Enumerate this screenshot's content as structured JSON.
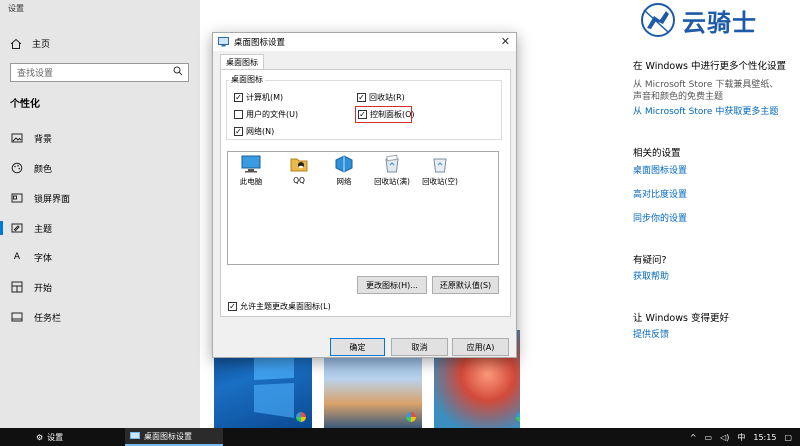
{
  "settings": {
    "title": "设置",
    "home": "主页",
    "search_placeholder": "查找设置",
    "section": "个性化",
    "nav": [
      {
        "label": "背景"
      },
      {
        "label": "颜色"
      },
      {
        "label": "锁屏界面"
      },
      {
        "label": "主题"
      },
      {
        "label": "字体"
      },
      {
        "label": "开始"
      },
      {
        "label": "任务栏"
      }
    ]
  },
  "logo": {
    "text": "云骑士"
  },
  "right_panel": {
    "heading1": "在 Windows 中进行更多个性化设置",
    "desc1_line1": "从 Microsoft Store 下载兼具壁纸、",
    "desc1_line2": "声音和颜色的免费主题",
    "link1": "从 Microsoft Store 中获取更多主题",
    "heading2": "相关的设置",
    "link2": "桌面图标设置",
    "link3": "高对比度设置",
    "link4": "同步你的设置",
    "heading3": "有疑问?",
    "link5": "获取帮助",
    "heading4": "让 Windows 变得更好",
    "link6": "提供反馈"
  },
  "dialog": {
    "title": "桌面图标设置",
    "tab": "桌面图标",
    "group_label": "桌面图标",
    "checkboxes": {
      "computer": {
        "label": "计算机(M)",
        "checked": true
      },
      "recycle": {
        "label": "回收站(R)",
        "checked": true
      },
      "user_files": {
        "label": "用户的文件(U)",
        "checked": false
      },
      "control_panel": {
        "label": "控制面板(O)",
        "checked": true
      },
      "network": {
        "label": "网络(N)",
        "checked": true
      }
    },
    "icons": [
      {
        "label": "此电脑"
      },
      {
        "label": "QQ"
      },
      {
        "label": "网络"
      },
      {
        "label": "回收站(满)"
      },
      {
        "label": "回收站(空)"
      }
    ],
    "change_icon": "更改图标(H)...",
    "restore_default": "还原默认值(S)",
    "allow_theme": {
      "label": "允许主题更改桌面图标(L)",
      "checked": true
    },
    "ok": "确定",
    "cancel": "取消",
    "apply": "应用(A)"
  },
  "taskbar": {
    "settings": "设置",
    "dialog": "桌面图标设置",
    "ime": "中",
    "time": "15:15"
  },
  "colors": {
    "accent": "#0078d7",
    "link": "#0067c0",
    "highlight": "#d32f2f"
  }
}
